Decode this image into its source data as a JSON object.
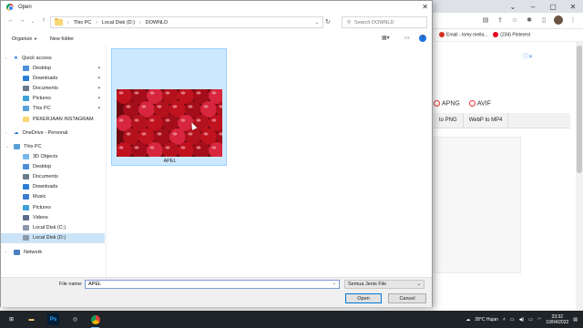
{
  "browser": {
    "bookmarks": [
      {
        "label": "Email - tomy meila...",
        "icon": "gmail-icon",
        "color": "#d93025"
      },
      {
        "label": "(234) Pinterest",
        "icon": "pinterest-icon",
        "color": "#e60023"
      }
    ],
    "formats": [
      "APNG",
      "AVIF"
    ],
    "convert_tabs": [
      "to PNG",
      "WebP to MP4"
    ]
  },
  "dialog": {
    "title": "Open",
    "breadcrumb": [
      "This PC",
      "Local Disk (D:)",
      "DOWNLD"
    ],
    "search_placeholder": "Search DOWNLD",
    "organize_label": "Organize",
    "newfolder_label": "New folder",
    "nav": {
      "quick_access": "Quick access",
      "quick_items": [
        {
          "label": "Desktop",
          "icon": "desktop-icon",
          "color": "#4a8fd8"
        },
        {
          "label": "Downloads",
          "icon": "downloads-icon",
          "color": "#2b7fd6"
        },
        {
          "label": "Documents",
          "icon": "documents-icon",
          "color": "#6b7b8c"
        },
        {
          "label": "Pictures",
          "icon": "pictures-icon",
          "color": "#3ea0d8"
        },
        {
          "label": "This PC",
          "icon": "this-pc-icon",
          "color": "#5aa0d8"
        },
        {
          "label": "PEKERJAAN INSTAGRAM",
          "icon": "folder-icon",
          "color": "#f8d775"
        }
      ],
      "onedrive": "OneDrive - Personal",
      "this_pc": "This PC",
      "pc_items": [
        {
          "label": "3D Objects",
          "icon": "3d-objects-icon",
          "color": "#7ab8e8"
        },
        {
          "label": "Desktop",
          "icon": "desktop-icon",
          "color": "#4a8fd8"
        },
        {
          "label": "Documents",
          "icon": "documents-icon",
          "color": "#6b7b8c"
        },
        {
          "label": "Downloads",
          "icon": "downloads-icon",
          "color": "#2b7fd6"
        },
        {
          "label": "Music",
          "icon": "music-icon",
          "color": "#3b7bd0"
        },
        {
          "label": "Pictures",
          "icon": "pictures-icon",
          "color": "#3ea0d8"
        },
        {
          "label": "Videos",
          "icon": "videos-icon",
          "color": "#5a6b8c"
        },
        {
          "label": "Local Disk (C:)",
          "icon": "drive-icon",
          "color": "#8a98a8"
        },
        {
          "label": "Local Disk (D:)",
          "icon": "drive-icon",
          "color": "#8a98a8",
          "selected": true
        }
      ],
      "network": "Network"
    },
    "file": {
      "name": "APEL"
    },
    "filename_label": "File name:",
    "filename_value": "APEL",
    "filetype_value": "Semua Jenis File",
    "open_label": "Open",
    "cancel_label": "Cancel"
  },
  "taskbar": {
    "weather": "28°C  Hujan",
    "time": "23:32",
    "date": "10/04/2022"
  }
}
